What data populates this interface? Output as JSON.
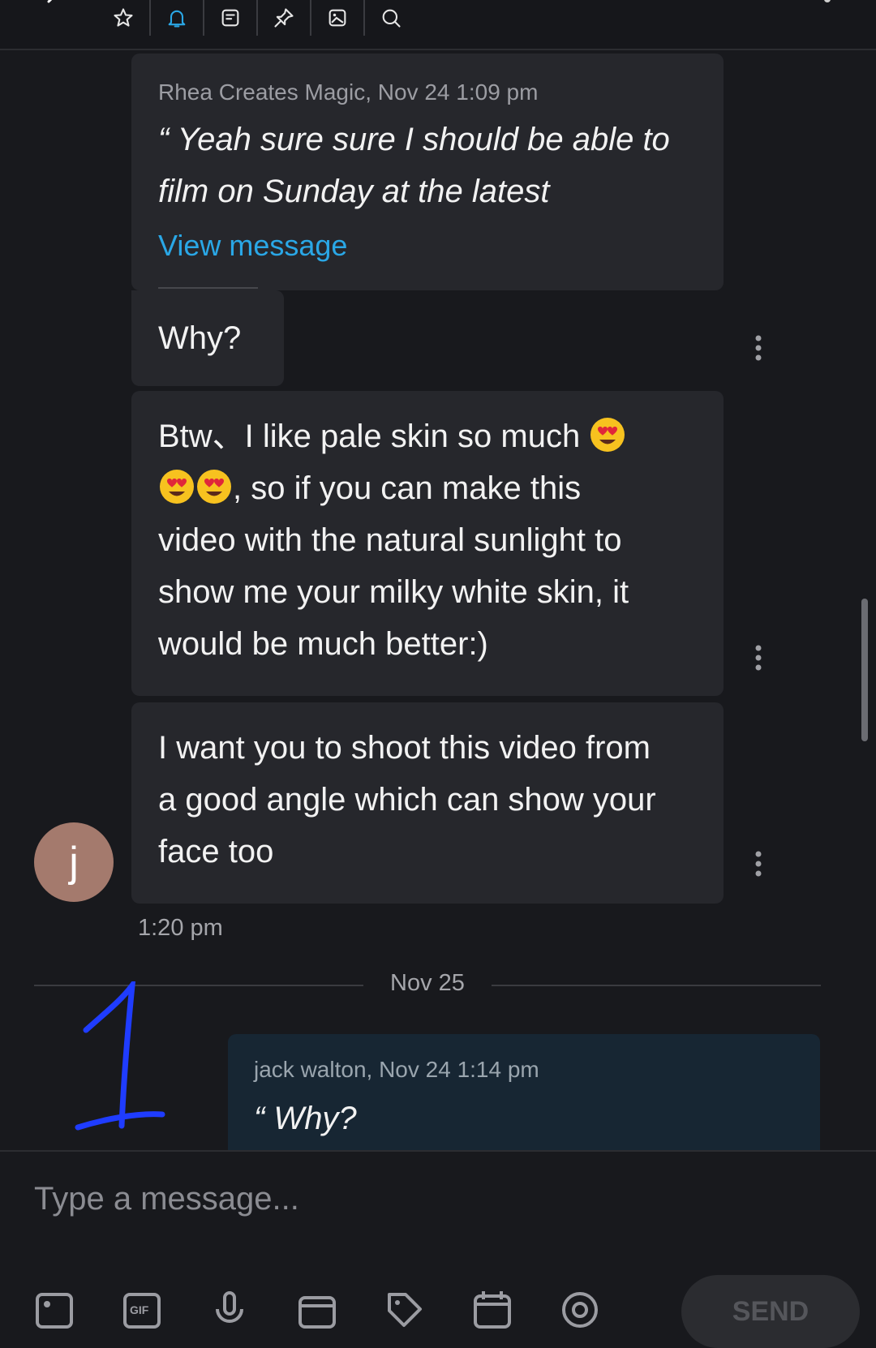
{
  "toolbar": {
    "icons": [
      "back-icon",
      "star-icon",
      "bell-icon",
      "notes-icon",
      "pin-icon",
      "image-icon",
      "search-icon",
      "more-icon"
    ],
    "accent_color": "#2aa7e6"
  },
  "messages": {
    "quote1": {
      "meta": "Rhea Creates Magic, Nov 24 1:09 pm",
      "text_line1": "“ Yeah sure sure I should be able to",
      "text_line2": "film on Sunday at the latest",
      "link": "View message"
    },
    "msg_why": "Why?",
    "msg_btw": {
      "line1": "Btw、I like pale skin so much",
      "line2_suffix": ", so if you can make this",
      "line3": "video with the natural sunlight to",
      "line4": "show me your milky white skin, it",
      "line5": "would be much better:)"
    },
    "msg_angle": {
      "line1": "I want you to shoot this video from",
      "line2": "a good angle which can show your",
      "line3": "face too"
    },
    "avatar_letter": "j",
    "time": "1:20 pm",
    "date_divider": "Nov 25",
    "quote2": {
      "meta": "jack walton, Nov 24 1:14 pm",
      "text": "“ Why?"
    }
  },
  "compose": {
    "placeholder": "Type a message...",
    "send_label": "SEND",
    "icons": [
      "camera-icon",
      "gif-icon",
      "microphone-icon",
      "wallet-icon",
      "tag-icon",
      "calendar-icon",
      "at-icon"
    ]
  }
}
